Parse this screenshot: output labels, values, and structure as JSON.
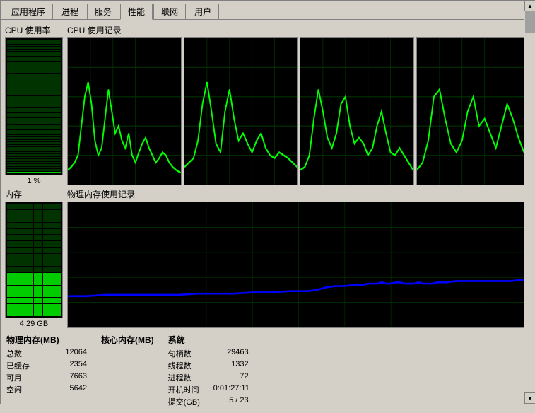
{
  "tabs": [
    {
      "label": "应用程序",
      "active": false
    },
    {
      "label": "进程",
      "active": false
    },
    {
      "label": "服务",
      "active": false
    },
    {
      "label": "性能",
      "active": true
    },
    {
      "label": "联网",
      "active": false
    },
    {
      "label": "用户",
      "active": false
    }
  ],
  "cpu_section": {
    "usage_label": "CPU 使用率",
    "history_label": "CPU 使用记录",
    "percent": "1 %",
    "graphs": 4
  },
  "mem_section": {
    "usage_label": "内存",
    "history_label": "物理内存使用记录",
    "value": "4.29 GB"
  },
  "physical_mem": {
    "header": "物理内存(MB)",
    "rows": [
      {
        "name": "总数",
        "value": "12064"
      },
      {
        "name": "已缓存",
        "value": "2354"
      },
      {
        "name": "可用",
        "value": "7663"
      },
      {
        "name": "空闲",
        "value": "5642"
      }
    ]
  },
  "system": {
    "header": "系统",
    "rows": [
      {
        "name": "句柄数",
        "value": "29463"
      },
      {
        "name": "线程数",
        "value": "1332"
      },
      {
        "name": "进程数",
        "value": "72"
      },
      {
        "name": "开机时间",
        "value": "0:01:27:11"
      },
      {
        "name": "提交(GB)",
        "value": "5 / 23"
      }
    ]
  },
  "kernel_mem": {
    "header": "核心内存(MB)"
  }
}
